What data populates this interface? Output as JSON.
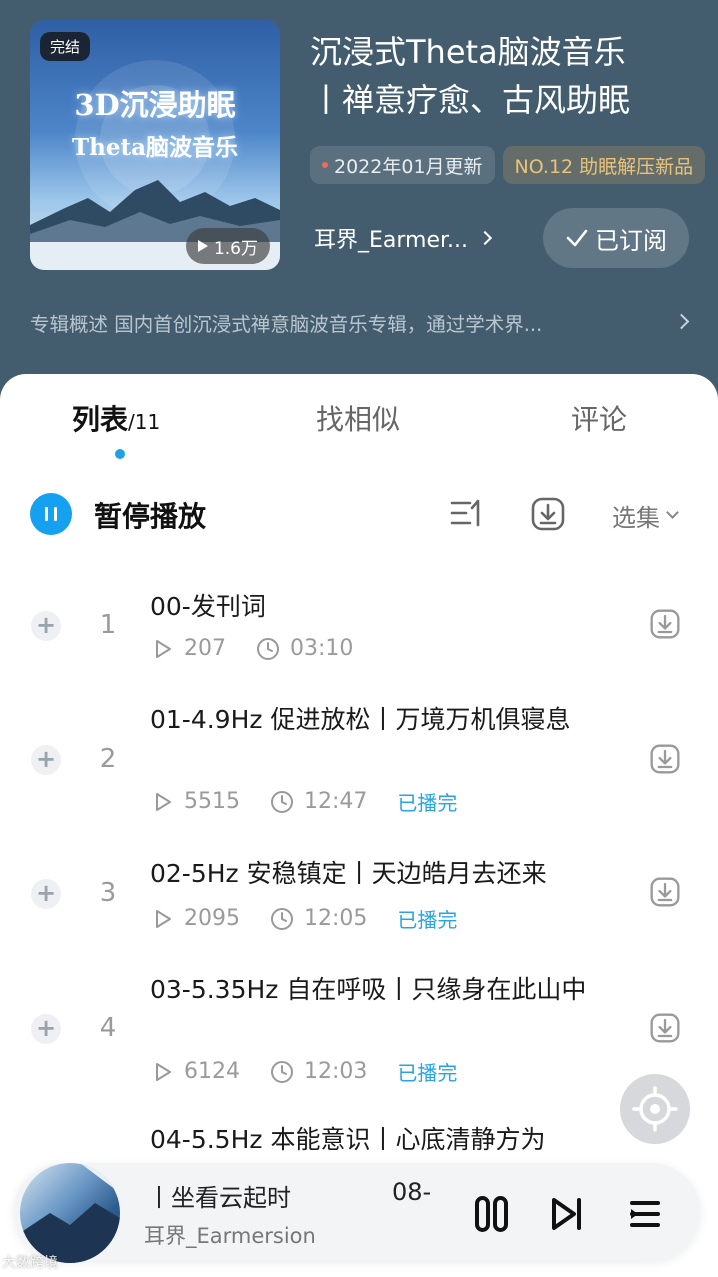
{
  "album": {
    "badge": "完结",
    "cover_line1": "3D沉浸助眠",
    "cover_line2": "Theta脑波音乐",
    "play_count": "1.6万",
    "title_line1": "沉浸式Theta脑波音乐",
    "title_line2": "丨禅意疗愈、古风助眠",
    "update_chip": "2022年01月更新",
    "rank_chip": "NO.12 助眠解压新品",
    "author": "耳界_Earmer...",
    "subscribe_label": "已订阅",
    "summary": "专辑概述 国内首创沉浸式禅意脑波音乐专辑，通过学术界..."
  },
  "tabs": {
    "list_label": "列表",
    "list_count": "/11",
    "similar_label": "找相似",
    "comment_label": "评论"
  },
  "toolbar": {
    "pause_label": "暂停播放",
    "select_label": "选集"
  },
  "tracks": [
    {
      "index": "1",
      "title": "00-发刊词",
      "plays": "207",
      "duration": "03:10",
      "status": ""
    },
    {
      "index": "2",
      "title": "01-4.9Hz 促进放松丨万境万机俱寝息",
      "plays": "5515",
      "duration": "12:47",
      "status": "已播完"
    },
    {
      "index": "3",
      "title": "02-5Hz 安稳镇定丨天边皓月去还来",
      "plays": "2095",
      "duration": "12:05",
      "status": "已播完"
    },
    {
      "index": "4",
      "title": "03-5.35Hz 自在呼吸丨只缘身在此山中",
      "plays": "6124",
      "duration": "12:03",
      "status": "已播完"
    },
    {
      "index": "",
      "title": "04-5.5Hz 本能意识丨心底清静方为",
      "plays": "",
      "duration": "",
      "status": ""
    }
  ],
  "player": {
    "title": "丨坐看云起时",
    "next_title": "08-",
    "author": "耳界_Earmersion"
  },
  "watermark": "大数跨境",
  "colors": {
    "header_bg": "#445d6e",
    "accent": "#16a1f0",
    "played": "#29a4e2",
    "rank": "#e9c37b"
  }
}
